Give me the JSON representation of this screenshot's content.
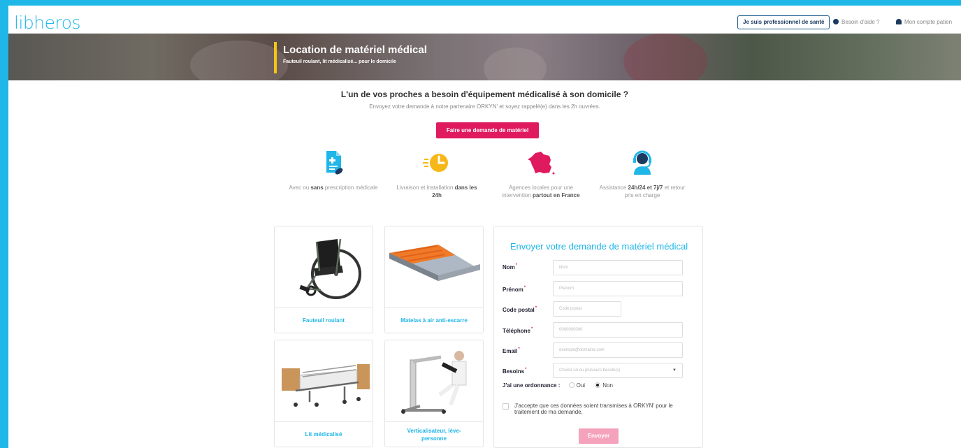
{
  "header": {
    "logo": "libheros",
    "pro_button": "Je suis professionnel de santé",
    "help": "Besoin d'aide ?",
    "account": "Mon compte patien"
  },
  "hero": {
    "title": "Location de matériel médical",
    "subtitle": "Fauteuil roulant, lit médicalisé... pour le domicile"
  },
  "intro": {
    "headline": "L'un de vos proches a besoin d'équipement médicalisé à son domicile ?",
    "subline": "Envoyez votre demande à notre partenaire ORKYN' et soyez rappelé(e) dans les 2h ouvrées.",
    "cta": "Faire une demande de matériel"
  },
  "features": [
    {
      "icon": "prescription-icon",
      "pre": "Avec ou ",
      "bold": "sans",
      "post": " prescription médicale",
      "bold2": "",
      "post2": ""
    },
    {
      "icon": "clock-icon",
      "pre": "Livraison et installation ",
      "bold": "dans les 24h",
      "post": "",
      "bold2": "",
      "post2": ""
    },
    {
      "icon": "france-map-icon",
      "pre": "Agences locales pour une intervention ",
      "bold": "partout en France",
      "post": "",
      "bold2": "",
      "post2": ""
    },
    {
      "icon": "headset-icon",
      "pre": "Assistance ",
      "bold": "24h/24 et 7j/7",
      "post": " et retour pris en charge",
      "bold2": "",
      "post2": ""
    }
  ],
  "products": [
    {
      "label": "Fauteuil roulant",
      "icon": "wheelchair-icon"
    },
    {
      "label": "Matelas à air anti-escarre",
      "icon": "air-mattress-icon"
    },
    {
      "label": "Lit médicalisé",
      "icon": "medical-bed-icon"
    },
    {
      "label": "Verticalisateur, lève-personne",
      "icon": "patient-lift-icon"
    }
  ],
  "form": {
    "title": "Envoyer votre demande de matériel médical",
    "required_mark": "*",
    "fields": {
      "nom": {
        "label": "Nom",
        "placeholder": "Nom"
      },
      "prenom": {
        "label": "Prénom",
        "placeholder": "Prénom"
      },
      "code_postal": {
        "label": "Code postal",
        "placeholder": "Code postal"
      },
      "telephone": {
        "label": "Téléphone",
        "placeholder": "0000000000"
      },
      "email": {
        "label": "Email",
        "placeholder": "exemple@domaine.com"
      },
      "besoins": {
        "label": "Besoins",
        "placeholder": "Choisir un ou plusieurs besoin(s)"
      }
    },
    "ordonnance": {
      "label": "J'ai une ordonnance :",
      "oui": "Oui",
      "non": "Non",
      "selected": "Non"
    },
    "consent": "J'accepte que ces données soient transmises à ORKYN' pour le traitement de ma demande.",
    "submit": "Envoyer"
  },
  "colors": {
    "brand": "#1fb6e8",
    "cta": "#e01a5f",
    "submit_disabled": "#f5a3bd",
    "accent_bar": "#f5c518"
  }
}
